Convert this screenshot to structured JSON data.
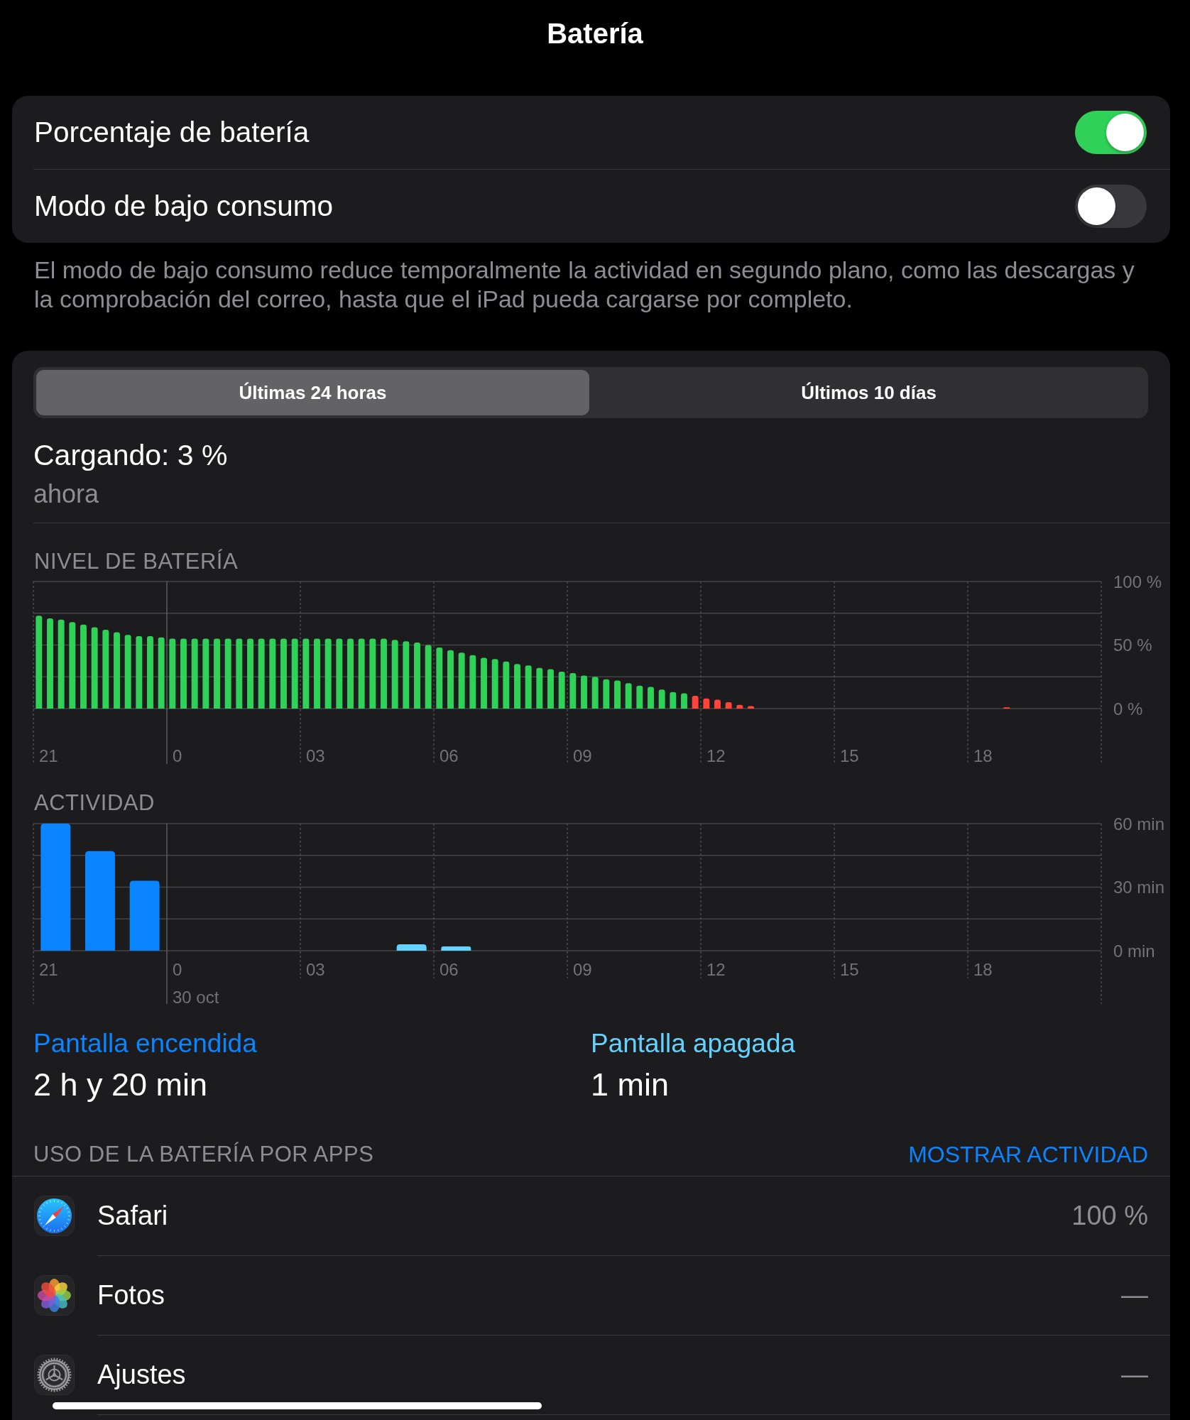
{
  "title": "Batería",
  "settings": [
    {
      "label": "Porcentaje de batería",
      "on": true
    },
    {
      "label": "Modo de bajo consumo",
      "on": false
    }
  ],
  "settings_footer": "El modo de bajo consumo reduce temporalmente la actividad en segundo plano, como las descargas y la comprobación del correo, hasta que el iPad pueda cargarse por completo.",
  "range_tabs": [
    {
      "label": "Últimas 24 horas",
      "selected": true
    },
    {
      "label": "Últimos 10 días",
      "selected": false
    }
  ],
  "status": {
    "title": "Cargando: 3 %",
    "time": "ahora"
  },
  "battery_level": {
    "chart_data": {
      "type": "bar",
      "title": "NIVEL DE BATERÍA",
      "categories": [
        null,
        "21",
        null,
        null,
        null,
        null,
        null,
        null,
        null,
        null,
        null,
        null,
        null,
        "0",
        null,
        null,
        null,
        null,
        null,
        null,
        null,
        null,
        null,
        null,
        null,
        "03",
        null,
        null,
        null,
        null,
        null,
        null,
        null,
        null,
        null,
        null,
        null,
        "06",
        null,
        null,
        null,
        null,
        null,
        null,
        null,
        null,
        null,
        null,
        null,
        "09",
        null,
        null,
        null,
        null,
        null,
        null,
        null,
        null,
        null,
        null,
        null,
        "12",
        null,
        null,
        null,
        null,
        null,
        null,
        null,
        null,
        null,
        null,
        null,
        "15",
        null,
        null,
        null,
        null,
        null,
        null,
        null,
        null,
        null,
        null,
        null,
        "18",
        null,
        null,
        null,
        null,
        null,
        null,
        null,
        null,
        null,
        null
      ],
      "ylim": [
        0,
        100
      ],
      "yticks": [
        {
          "value": 0,
          "label": "0 %"
        },
        {
          "value": 50,
          "label": "50 %"
        },
        {
          "value": 100,
          "label": "100 %"
        }
      ],
      "series": [
        {
          "color": "#30d158",
          "values": [
            73,
            71,
            70,
            68,
            66,
            64,
            62,
            60,
            58,
            57,
            57,
            56,
            55,
            55,
            55,
            55,
            55,
            55,
            55,
            55,
            55,
            55,
            55,
            55,
            55,
            55,
            55,
            55,
            55,
            55,
            55,
            55,
            54,
            53,
            52,
            50,
            48,
            46,
            44,
            42,
            40,
            39,
            37,
            35,
            34,
            32,
            31,
            29,
            28,
            26,
            25,
            23,
            22,
            20,
            18,
            17,
            15,
            13,
            12,
            null,
            null,
            null,
            null,
            null,
            null,
            null,
            null,
            null,
            null,
            null,
            null,
            null,
            null,
            null,
            null,
            null,
            null,
            null,
            null,
            null,
            null,
            null,
            null,
            null,
            null,
            null,
            null,
            null,
            null,
            null,
            null,
            null,
            null,
            null,
            null,
            null
          ]
        },
        {
          "color": "#ff453a",
          "values": [
            null,
            null,
            null,
            null,
            null,
            null,
            null,
            null,
            null,
            null,
            null,
            null,
            null,
            null,
            null,
            null,
            null,
            null,
            null,
            null,
            null,
            null,
            null,
            null,
            null,
            null,
            null,
            null,
            null,
            null,
            null,
            null,
            null,
            null,
            null,
            null,
            null,
            null,
            null,
            null,
            null,
            null,
            null,
            null,
            null,
            null,
            null,
            null,
            null,
            null,
            null,
            null,
            null,
            null,
            null,
            null,
            null,
            null,
            null,
            10,
            8,
            7,
            5,
            3,
            2,
            null,
            null,
            null,
            null,
            null,
            null,
            null,
            null,
            null,
            null,
            null,
            null,
            null,
            null,
            null,
            null,
            null,
            null,
            null,
            null,
            null,
            null,
            1,
            null,
            null,
            null,
            null,
            null,
            null,
            null,
            null
          ]
        }
      ]
    }
  },
  "activity": {
    "chart_data": {
      "type": "bar",
      "title": "ACTIVIDAD",
      "categories": [
        "21",
        null,
        null,
        "0",
        null,
        null,
        "03",
        null,
        null,
        "06",
        null,
        null,
        "09",
        null,
        null,
        "12",
        null,
        null,
        "15",
        null,
        null,
        "18",
        null,
        null
      ],
      "ylim": [
        0,
        60
      ],
      "yticks": [
        {
          "value": 0,
          "label": "0 min"
        },
        {
          "value": 30,
          "label": "30 min"
        },
        {
          "value": 60,
          "label": "60 min"
        }
      ],
      "series": [
        {
          "color": "#0a84ff",
          "values": [
            60,
            47,
            33,
            null,
            null,
            null,
            null,
            null,
            null,
            null,
            null,
            null,
            null,
            null,
            null,
            null,
            null,
            null,
            null,
            null,
            null,
            null,
            null,
            null
          ]
        },
        {
          "color": "#64d2ff",
          "values": [
            null,
            null,
            null,
            null,
            null,
            null,
            null,
            null,
            3,
            2,
            null,
            null,
            null,
            null,
            null,
            null,
            null,
            null,
            null,
            null,
            null,
            null,
            null,
            null
          ]
        }
      ],
      "annotations": [
        "30 oct"
      ]
    }
  },
  "screen_time": [
    {
      "label": "Pantalla encendida",
      "value": "2 h y 20 min",
      "color": "#0a84ff"
    },
    {
      "label": "Pantalla apagada",
      "value": "1 min",
      "color": "#64d2ff"
    }
  ],
  "app_usage": {
    "heading": "USO DE LA BATERÍA POR APPS",
    "action": "MOSTRAR ACTIVIDAD",
    "apps": [
      {
        "name": "Safari",
        "value": "100 %"
      },
      {
        "name": "Fotos",
        "value": "—"
      },
      {
        "name": "Ajustes",
        "value": "—"
      }
    ]
  }
}
